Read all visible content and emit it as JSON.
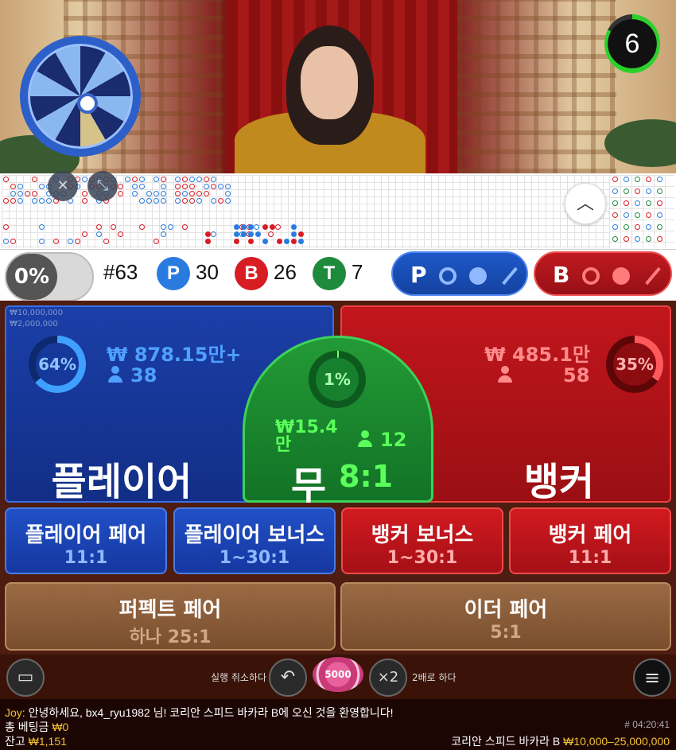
{
  "timer": {
    "seconds": "6"
  },
  "stats": {
    "progress_label": "0%",
    "round": "#63",
    "player_badge": "P",
    "player_count": "30",
    "banker_badge": "B",
    "banker_count": "26",
    "tie_badge": "T",
    "tie_count": "7"
  },
  "predict": {
    "player_label": "P",
    "banker_label": "B"
  },
  "limits": {
    "max": "₩10,000,000",
    "min": "₩2,000,000"
  },
  "player": {
    "percent": "64%",
    "amount": "₩ 878.15만+",
    "players": "38",
    "label": "플레이어"
  },
  "banker": {
    "percent": "35%",
    "amount": "₩ 485.1만",
    "players": "58",
    "label": "뱅커"
  },
  "tie": {
    "percent": "1%",
    "amount": "₩15.4만",
    "players": "12",
    "label": "무",
    "odds": "8:1"
  },
  "side_bets": [
    {
      "label": "플레이어 페어",
      "odds": "11:1"
    },
    {
      "label": "플레이어 보너스",
      "odds": "1~30:1"
    },
    {
      "label": "뱅커 보너스",
      "odds": "1~30:1"
    },
    {
      "label": "뱅커 페어",
      "odds": "11:1"
    }
  ],
  "perfect_pair": {
    "label": "퍼펙트 페어",
    "odds": "하나 25:1"
  },
  "either_pair": {
    "label": "이더 페어",
    "odds": "5:1"
  },
  "toolbar": {
    "undo_label": "실행 취소하다",
    "chip_value": "5000",
    "double_icon": "×2",
    "double_label": "2배로 하다"
  },
  "chat": {
    "sender": "Joy:",
    "message": "안녕하세요, bx4_ryu1982 님! 코리안 스피드 바카라 B에 오신 것을 환영합니다!"
  },
  "footer": {
    "total_bet_label": "총 베팅금",
    "total_bet_value": "₩0",
    "balance_label": "잔고",
    "balance_value": "₩1,151",
    "game_id": "# 04:20:41",
    "game_name": "코리안 스피드 바카라 B",
    "limits": "₩10,000–25,000,000"
  },
  "colors": {
    "player": "#1b3fa8",
    "banker": "#c1161c",
    "tie": "#239a36",
    "gold": "#f1c232"
  }
}
